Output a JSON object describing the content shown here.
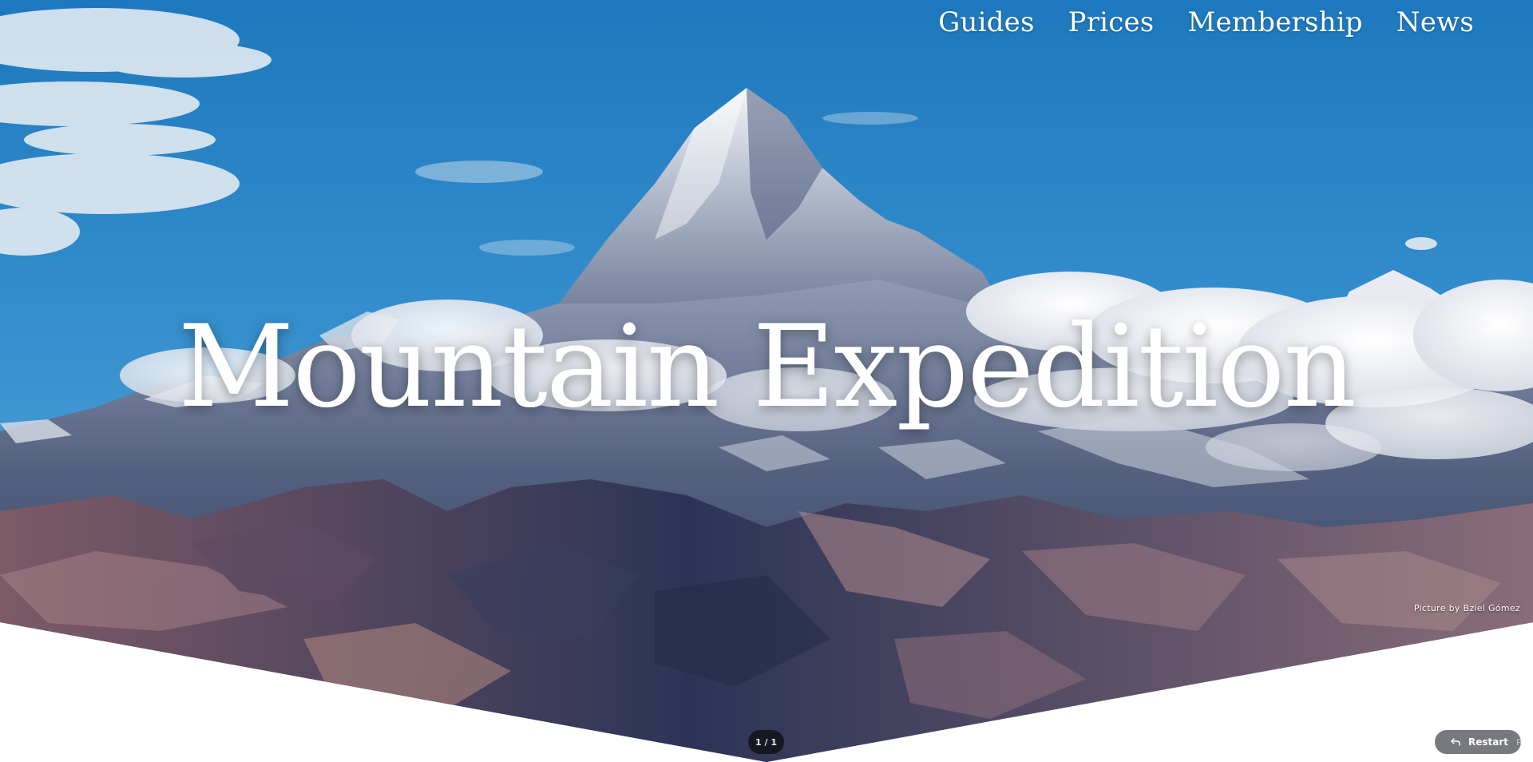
{
  "nav": {
    "items": [
      {
        "label": "Guides"
      },
      {
        "label": "Prices"
      },
      {
        "label": "Membership"
      },
      {
        "label": "News"
      }
    ]
  },
  "hero": {
    "title": "Mountain Expedition",
    "credit": "Picture by Bziel Gómez"
  },
  "controls": {
    "slide_counter": "1 / 1",
    "restart_label": "Restart",
    "restart_shortcut": "R",
    "restart_icon": "undo-arrow-icon"
  },
  "colors": {
    "sky_top": "#1f7fc2",
    "sky_bottom": "#6fb3de",
    "cloud": "#f2f0ee",
    "rock_dark": "#2a3352",
    "rock_warm": "#8a6a74",
    "rock_light": "#b48b86",
    "snow": "#e9ecf1",
    "background": "#ffffff",
    "counter_bg": "#14161c",
    "restart_bg": "#5f6269"
  }
}
